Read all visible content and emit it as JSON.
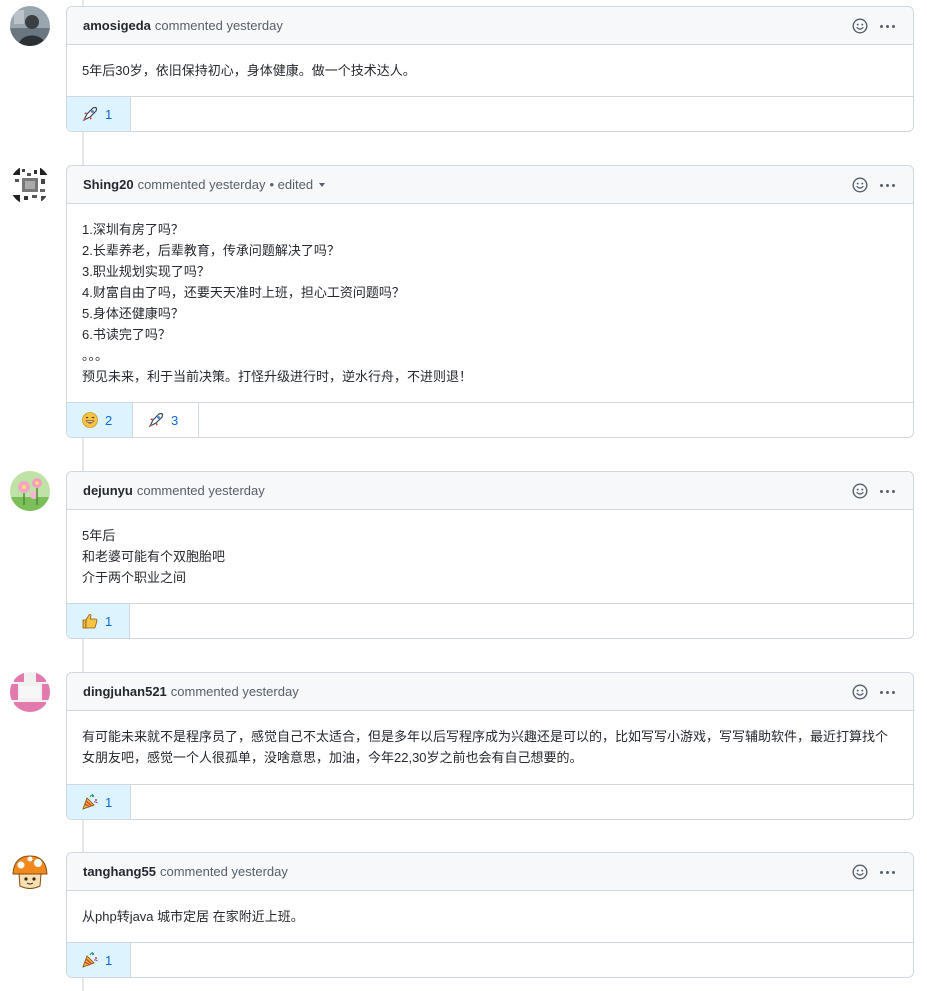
{
  "comments": [
    {
      "author": "amosigeda",
      "meta": "commented yesterday",
      "edited": "",
      "body": [
        "5年后30岁，依旧保持初心，身体健康。做一个技术达人。"
      ],
      "reactions": [
        {
          "icon": "rocket-icon",
          "count": "1"
        }
      ]
    },
    {
      "author": "Shing20",
      "meta": "commented yesterday",
      "edited": "• edited",
      "body": [
        "1.深圳有房了吗？",
        "2.长辈养老，后辈教育，传承问题解决了吗？",
        "3.职业规划实现了吗？",
        "4.财富自由了吗，还要天天准时上班，担心工资问题吗？",
        "5.身体还健康吗？",
        "6.书读完了吗？",
        "。。。",
        "预见未来，利于当前决策。打怪升级进行时，逆水行舟，不进则退！"
      ],
      "reactions": [
        {
          "icon": "laugh-icon",
          "count": "2"
        },
        {
          "icon": "rocket-icon",
          "count": "3"
        }
      ]
    },
    {
      "author": "dejunyu",
      "meta": "commented yesterday",
      "edited": "",
      "body": [
        "5年后",
        "和老婆可能有个双胞胎吧",
        "介于两个职业之间"
      ],
      "reactions": [
        {
          "icon": "thumbs-up-icon",
          "count": "1"
        }
      ]
    },
    {
      "author": "dingjuhan521",
      "meta": "commented yesterday",
      "edited": "",
      "body": [
        "有可能未来就不是程序员了，感觉自己不太适合，但是多年以后写程序成为兴趣还是可以的，比如写写小游戏，写写辅助软件，最近打算找个女朋友吧，感觉一个人很孤单，没啥意思，加油，今年22,30岁之前也会有自己想要的。"
      ],
      "reactions": [
        {
          "icon": "party-popper-icon",
          "count": "1"
        }
      ]
    },
    {
      "author": "tanghang55",
      "meta": "commented yesterday",
      "edited": "",
      "body": [
        "从php转java 城市定居 在家附近上班。"
      ],
      "reactions": [
        {
          "icon": "party-popper-icon",
          "count": "1"
        }
      ]
    }
  ],
  "colors": {
    "link": "#0969da",
    "reaction_bg": "#ddf4ff",
    "border": "#d0d7de",
    "header_bg": "#f6f8fa"
  }
}
